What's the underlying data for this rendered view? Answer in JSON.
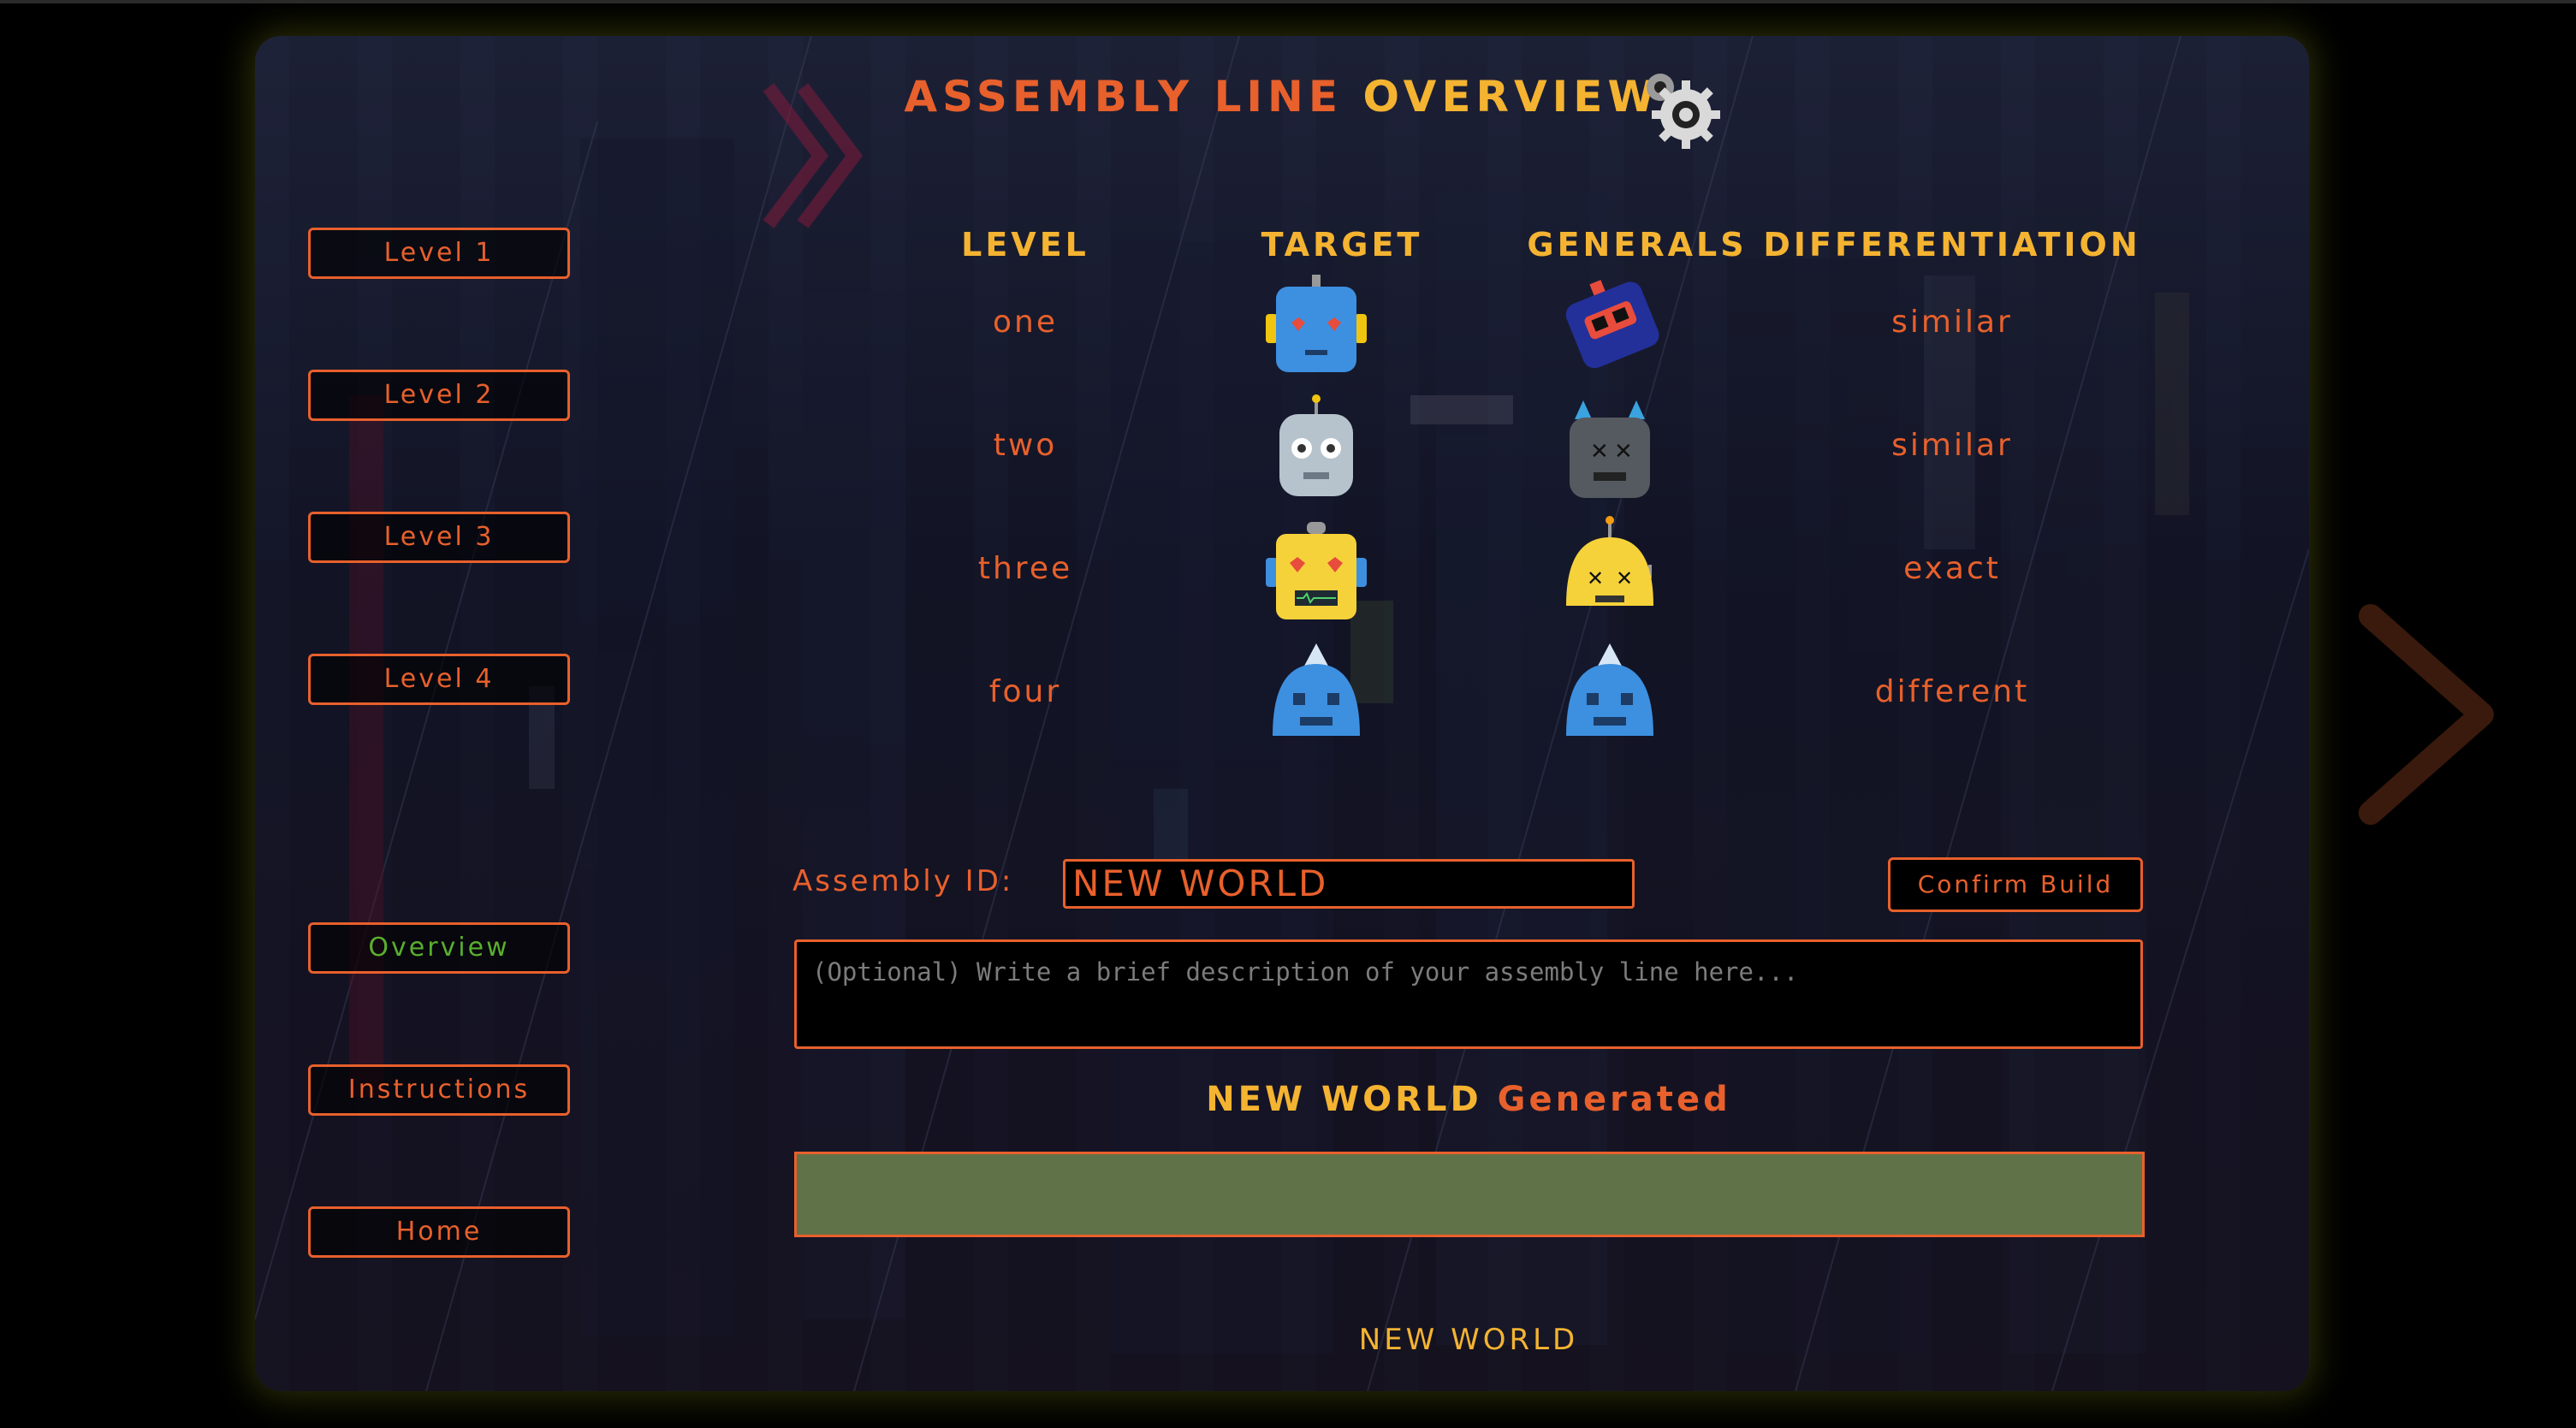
{
  "header": {
    "title_part1": "ASSEMBLY LINE",
    "title_part2": "Overview",
    "icon": "gear-icon"
  },
  "sidebar": {
    "items": [
      {
        "label": "Level 1",
        "active": false
      },
      {
        "label": "Level 2",
        "active": false
      },
      {
        "label": "Level 3",
        "active": false
      },
      {
        "label": "Level 4",
        "active": false
      },
      {
        "label": "Overview",
        "active": true
      },
      {
        "label": "Instructions",
        "active": false
      },
      {
        "label": "Home",
        "active": false
      }
    ]
  },
  "table": {
    "headers": [
      "Level",
      "Target",
      "Generals",
      "Differentiation"
    ],
    "rows": [
      {
        "level": "one",
        "target_icon": "blue-robot-heart-eyes-icon",
        "general_icon": "navy-robot-icon",
        "differentiation": "similar"
      },
      {
        "level": "two",
        "target_icon": "grey-robot-icon",
        "general_icon": "grey-horned-robot-icon",
        "differentiation": "similar"
      },
      {
        "level": "three",
        "target_icon": "yellow-robot-heart-eyes-icon",
        "general_icon": "yellow-round-robot-icon",
        "differentiation": "exact"
      },
      {
        "level": "four",
        "target_icon": "blue-spike-robot-icon",
        "general_icon": "blue-spike-robot-icon",
        "differentiation": "different"
      }
    ]
  },
  "assembly": {
    "id_label": "Assembly ID:",
    "id_value": "NEW WORLD",
    "confirm_label": "Confirm Build",
    "description_placeholder": "(Optional) Write a brief description of your assembly line here..."
  },
  "generated": {
    "name": "NEW WORLD",
    "suffix": "Generated",
    "bar_color": "#5f7248",
    "footer_word": "NEW WORLD"
  },
  "colors": {
    "orange": "#e8602c",
    "gold": "#f4b331",
    "green_active": "#58b02e"
  }
}
